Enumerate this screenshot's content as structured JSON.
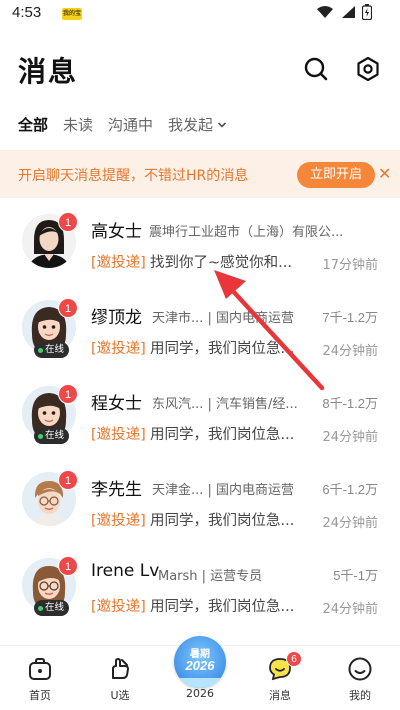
{
  "status_bar": {
    "time": "4:53",
    "app_badge": "我的宝"
  },
  "header": {
    "title": "消息"
  },
  "tabs": [
    {
      "label": "全部",
      "active": true
    },
    {
      "label": "未读",
      "active": false
    },
    {
      "label": "沟通中",
      "active": false
    },
    {
      "label": "我发起",
      "active": false,
      "has_dropdown": true
    }
  ],
  "banner": {
    "text": "开启聊天消息提醒，不错过HR的消息",
    "button": "立即开启",
    "close": "✕"
  },
  "conversations": [
    {
      "name": "高女士",
      "company": "震坤行工业超市（上海）有限公...",
      "salary": "",
      "unread": "1",
      "online": false,
      "online_label": "",
      "tag": "[邀投递]",
      "preview": "找到你了~感觉你和...",
      "time": "17分钟前"
    },
    {
      "name": "缪顶龙",
      "company": "天津市... | 国内电商运营",
      "salary": "7千-1.2万",
      "unread": "1",
      "online": true,
      "online_label": "在线",
      "tag": "[邀投递]",
      "preview": "用同学，我们岗位急...",
      "time": "24分钟前"
    },
    {
      "name": "程女士",
      "company": "东风汽... | 汽车销售/经...",
      "salary": "8千-1.2万",
      "unread": "1",
      "online": true,
      "online_label": "在线",
      "tag": "[邀投递]",
      "preview": "用同学，我们岗位急...",
      "time": "24分钟前"
    },
    {
      "name": "李先生",
      "company": "天津金... | 国内电商运营",
      "salary": "6千-1.2万",
      "unread": "1",
      "online": false,
      "online_label": "",
      "tag": "[邀投递]",
      "preview": "用同学，我们岗位急...",
      "time": "24分钟前"
    },
    {
      "name": "Irene Lv",
      "company": "Marsh | 运营专员",
      "salary": "5千-1万",
      "unread": "1",
      "online": true,
      "online_label": "在线",
      "tag": "[邀投递]",
      "preview": "用同学，我们岗位急...",
      "time": "24分钟前"
    }
  ],
  "bottom_nav": [
    {
      "label": "首页",
      "icon": "home-bag-icon"
    },
    {
      "label": "U选",
      "icon": "hand-heart-icon"
    },
    {
      "label": "2026",
      "icon": "summer-badge-icon",
      "badge_line1": "暑期",
      "badge_line2": "2026"
    },
    {
      "label": "消息",
      "icon": "chat-bubble-icon",
      "badge": "6",
      "active": true
    },
    {
      "label": "我的",
      "icon": "profile-face-icon"
    }
  ],
  "colors": {
    "accent_orange": "#f4873a",
    "banner_bg": "#fdf0e6",
    "unread_red": "#f04848",
    "annotation_red": "#e8363a"
  }
}
